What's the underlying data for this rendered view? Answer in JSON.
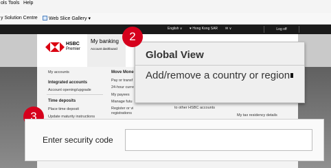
{
  "menubar": {
    "items": [
      "ols",
      "Tools",
      "Help"
    ]
  },
  "favorites": {
    "items": [
      "y Solution Centre",
      "Web Slice Gallery ▾"
    ]
  },
  "topbar": {
    "language": "English ∨",
    "region": "♥ Hong Kong SAR",
    "mail": "✉ ∨",
    "logoff": "Log off"
  },
  "header": {
    "brand_name": "HSBC",
    "brand_sub": "Premier",
    "tab_title": "My banking",
    "tab_subtitle": "Account dashboard"
  },
  "menu": {
    "col1": [
      "My accounts",
      "Integrated accounts",
      "Account opening/upgrade",
      "Time deposits",
      "Place time deposit",
      "Update maturity instructions"
    ],
    "col2": [
      "Move Mone",
      "Pay or transf",
      "24-hour curre",
      "My payees",
      "Manage futu",
      "Register or vi",
      "registrations"
    ],
    "col3_frag": "to other HSBC accounts",
    "col4_frag": "My tax residency details"
  },
  "popup": {
    "title": "Global View",
    "link": "Add/remove a country or region"
  },
  "security": {
    "label": "Enter security code",
    "value": ""
  },
  "badges": {
    "b2": "2",
    "b3": "3"
  },
  "colors": {
    "accent_red": "#d6001c",
    "topbar": "#1a1a1a"
  }
}
